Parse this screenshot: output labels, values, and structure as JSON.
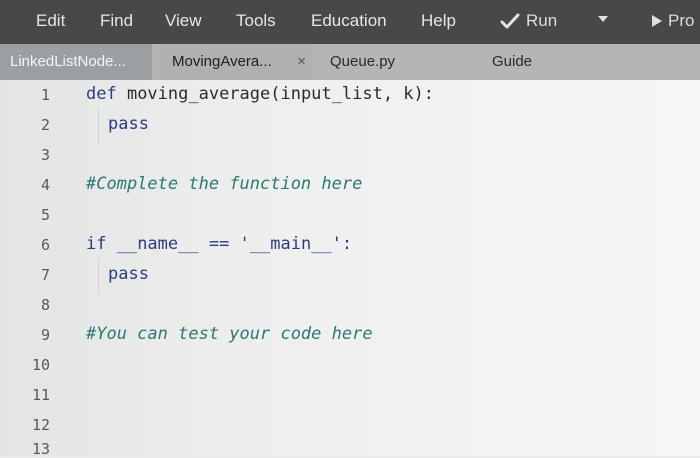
{
  "menu": {
    "items": [
      "Edit",
      "Find",
      "View",
      "Tools",
      "Education",
      "Help"
    ],
    "run_label": "Run",
    "pro_label": "Pro"
  },
  "tabs": {
    "first": "LinkedListNode...",
    "active": "MovingAvera...",
    "active_close": "×",
    "third": "Queue.py",
    "guide": "Guide"
  },
  "editor": {
    "line_numbers": [
      "1",
      "2",
      "3",
      "4",
      "5",
      "6",
      "7",
      "8",
      "9",
      "10",
      "11",
      "12",
      "13"
    ],
    "code": {
      "l1_kw": "def",
      "l1_rest": " moving_average(input_list, k):",
      "l2": "pass",
      "l4": "#Complete the function here",
      "l6_kw": "if",
      "l6_rest": " __name__ == '__main__':",
      "l7": "pass",
      "l9": "#You can test your code here"
    }
  },
  "colors": {
    "menubar": "#47484a",
    "tabbar": "#b3b5b7",
    "keyword": "#2e3b83",
    "comment": "#2a7a73"
  }
}
